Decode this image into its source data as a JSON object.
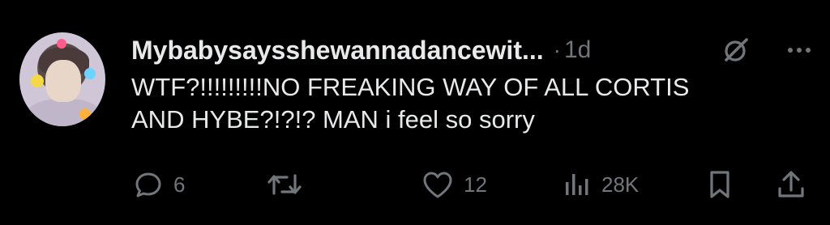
{
  "post": {
    "display_name": "Mybabysaysshewannadancewit...",
    "separator": "·",
    "time": "1d",
    "text_line1": "WTF?!!!!!!!!!NO FREAKING WAY OF ALL CORTIS",
    "text_line2": "AND HYBE?!?!? MAN i feel so sorry"
  },
  "actions": {
    "replies": "6",
    "reposts": "",
    "likes": "12",
    "views": "28K"
  },
  "icons": {
    "reply": "reply-icon",
    "repost": "repost-icon",
    "like": "heart-icon",
    "views": "views-icon",
    "bookmark": "bookmark-icon",
    "share": "share-icon",
    "grok": "grok-icon",
    "more": "more-icon"
  },
  "colors": {
    "background": "#000000",
    "text": "#e7e9ea",
    "muted": "#71767b"
  }
}
